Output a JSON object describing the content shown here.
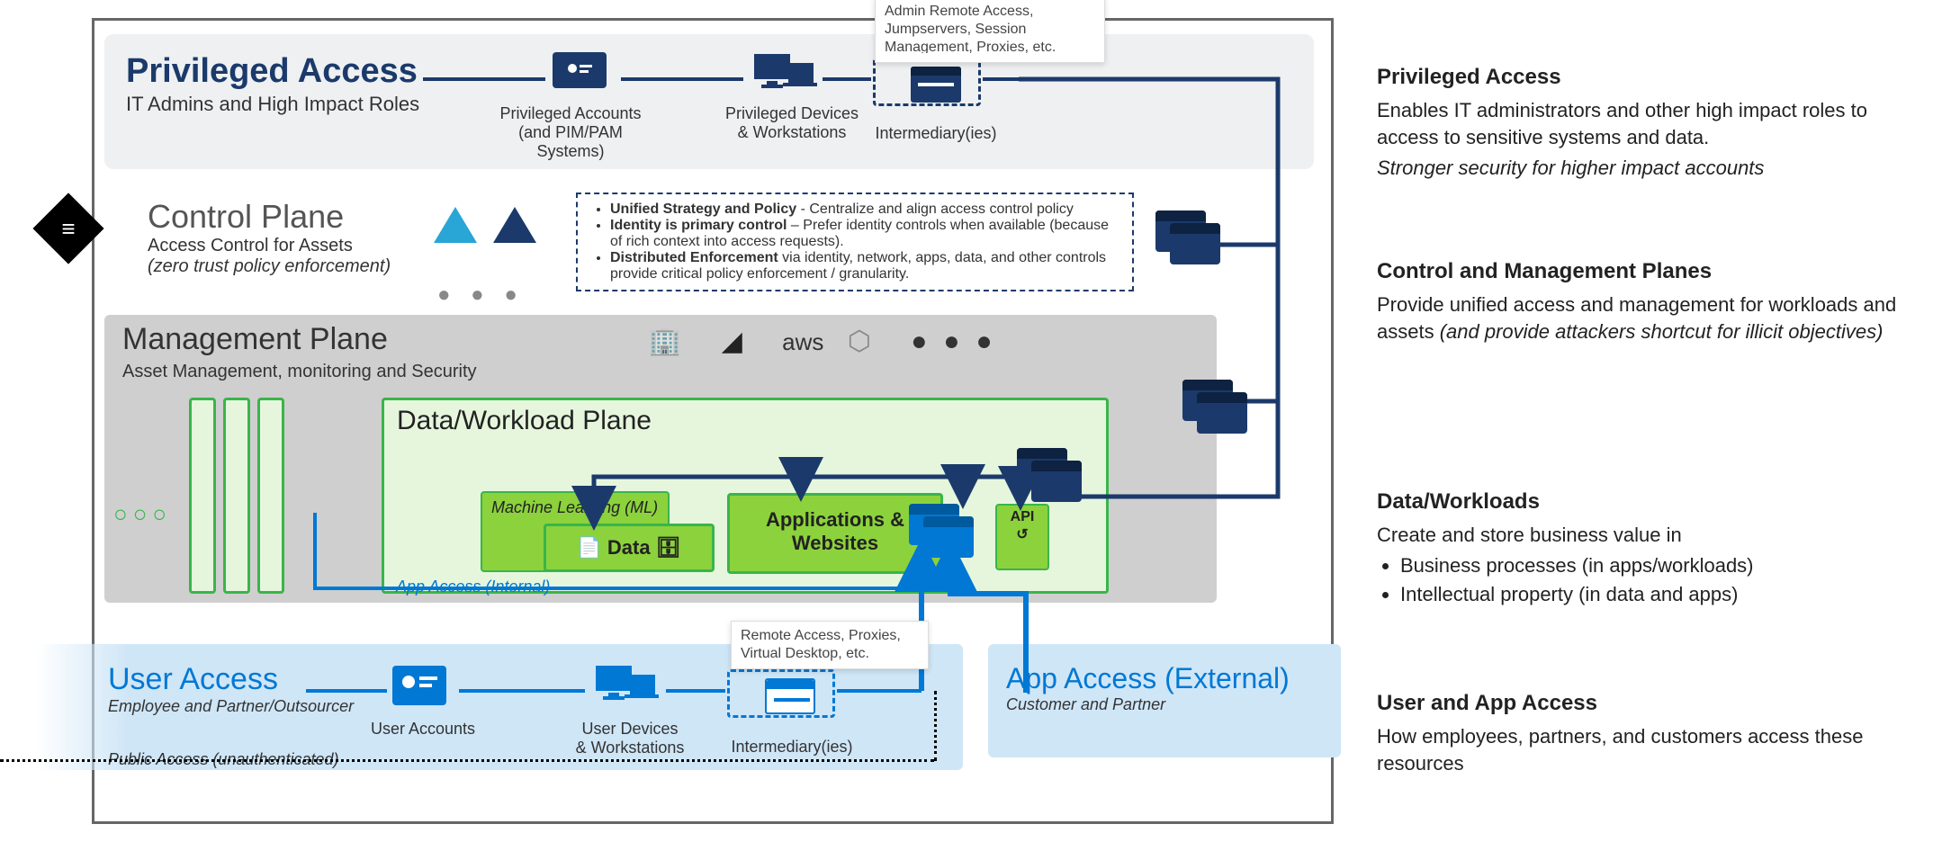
{
  "privileged": {
    "title": "Privileged Access",
    "subtitle": "IT Admins and High Impact Roles",
    "accounts_label": "Privileged Accounts\n(and PIM/PAM Systems)",
    "devices_label": "Privileged Devices\n& Workstations",
    "intermediary_label": "Intermediary(ies)",
    "callout": "Admin Remote Access, Jumpservers, Session Management, Proxies, etc."
  },
  "control": {
    "title": "Control Plane",
    "subtitle": "Access Control for Assets",
    "subtitle2": "(zero trust policy enforcement)",
    "policy": {
      "b1": "Unified Strategy and Policy",
      "t1": " - Centralize and align access control policy",
      "b2": "Identity is primary control",
      "t2": " – Prefer identity controls when available (because of rich context into access requests).",
      "b3": "Distributed Enforcement",
      "t3": " via identity, network, apps, data, and other controls provide critical policy enforcement / granularity."
    }
  },
  "management": {
    "title": "Management Plane",
    "subtitle": "Asset Management, monitoring and Security"
  },
  "dataworkload": {
    "title": "Data/Workload Plane",
    "ml": "Machine Learning (ML)",
    "data": "Data",
    "apps": "Applications & Websites",
    "api": "API",
    "app_access_internal": "App Access (Internal)"
  },
  "user": {
    "title": "User Access",
    "subtitle": "Employee and Partner/Outsourcer",
    "accounts_label": "User Accounts",
    "devices_label": "User Devices\n& Workstations",
    "intermediary_label": "Intermediary(ies)",
    "public": "Public Access (unauthenticated)",
    "callout": "Remote Access, Proxies, Virtual Desktop, etc."
  },
  "external": {
    "title": "App Access (External)",
    "subtitle": "Customer and Partner"
  },
  "right": {
    "r1_title": "Privileged Access",
    "r1_body": "Enables IT administrators and other high impact roles to access to sensitive systems and data.",
    "r1_em": "Stronger security for higher impact accounts",
    "r2_title": "Control and Management Planes",
    "r2_body": "Provide unified access and management for workloads and assets ",
    "r2_em": "(and provide attackers shortcut for illicit objectives)",
    "r3_title": "Data/Workloads",
    "r3_body": "Create and store business value in",
    "r3_li1": "Business processes (in apps/workloads)",
    "r3_li2": "Intellectual property (in data and apps)",
    "r4_title": "User and App Access",
    "r4_body": "How employees, partners, and customers access these resources"
  }
}
